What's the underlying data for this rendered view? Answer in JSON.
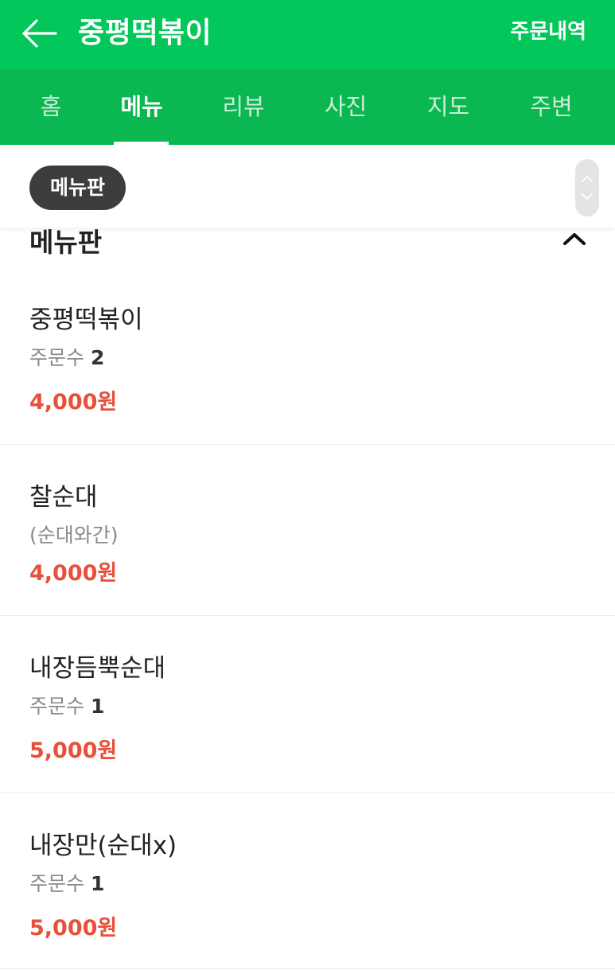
{
  "header": {
    "title": "중평떡볶이",
    "order_history": "주문내역",
    "color": "#03c75a"
  },
  "tabs": [
    {
      "label": "홈",
      "active": false
    },
    {
      "label": "메뉴",
      "active": true
    },
    {
      "label": "리뷰",
      "active": false
    },
    {
      "label": "사진",
      "active": false
    },
    {
      "label": "지도",
      "active": false
    },
    {
      "label": "주변",
      "active": false
    }
  ],
  "filter": {
    "chip_label": "메뉴판"
  },
  "section": {
    "title": "메뉴판"
  },
  "menu_items": [
    {
      "name": "중평떡볶이",
      "sub_label": "주문수",
      "sub_count": "2",
      "price": "4,000원"
    },
    {
      "name": "찰순대",
      "description": "(순대와간)",
      "price": "4,000원"
    },
    {
      "name": "내장듬뿍순대",
      "sub_label": "주문수",
      "sub_count": "1",
      "price": "5,000원"
    },
    {
      "name": "내장만(순대x)",
      "sub_label": "주문수",
      "sub_count": "1",
      "price": "5,000원"
    }
  ],
  "icons": {
    "back": "arrow-left-icon",
    "collapse": "chevron-up-icon",
    "scroll_up": "chevron-up-icon",
    "scroll_down": "chevron-down-icon"
  },
  "price_color": "#e8503a"
}
